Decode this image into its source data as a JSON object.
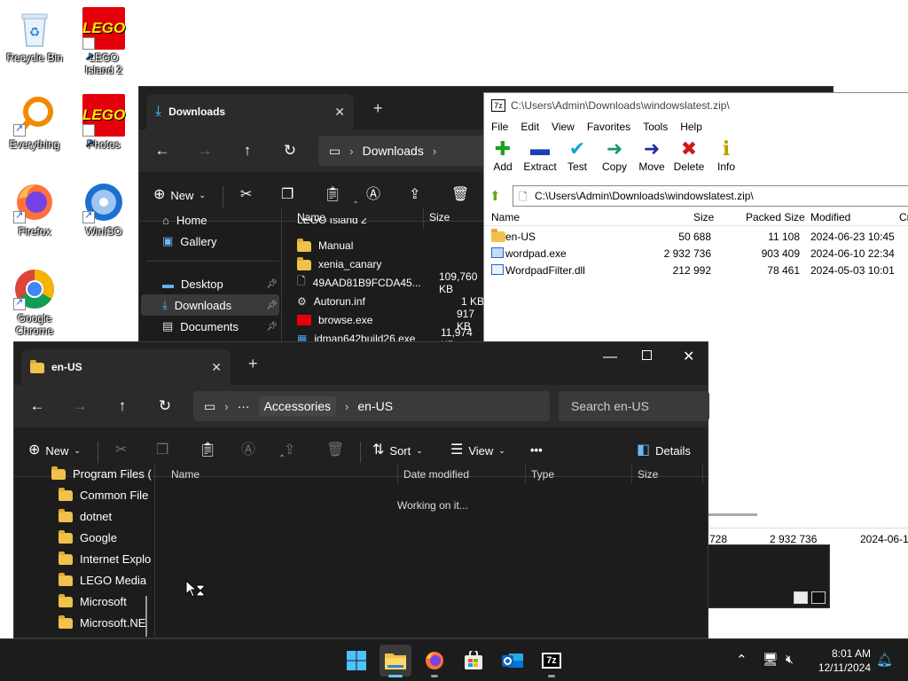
{
  "desktop": {
    "icons": [
      {
        "label": "Recycle Bin",
        "icon": "recycle-bin-icon"
      },
      {
        "label": "LEGO Island 2",
        "icon": "lego-icon"
      },
      {
        "label": "Everything",
        "icon": "everything-search-icon"
      },
      {
        "label": "Photos",
        "icon": "lego-icon"
      },
      {
        "label": "Firefox",
        "icon": "firefox-icon"
      },
      {
        "label": "WinISO",
        "icon": "disc-icon"
      },
      {
        "label": "Google Chrome",
        "icon": "chrome-icon"
      }
    ],
    "lego_text": "LEGO"
  },
  "downloads_window": {
    "tab_title": "Downloads",
    "breadcrumb": "Downloads",
    "commands": {
      "new": "New"
    },
    "nav": [
      {
        "label": "Home",
        "icon": "home-icon"
      },
      {
        "label": "Gallery",
        "icon": "gallery-icon"
      },
      {
        "label": "Desktop",
        "icon": "desktop-icon",
        "pinned": true
      },
      {
        "label": "Downloads",
        "icon": "download-icon",
        "pinned": true,
        "selected": true
      },
      {
        "label": "Documents",
        "icon": "documents-icon",
        "pinned": true
      }
    ],
    "columns": {
      "name": "Name",
      "size": "Size"
    },
    "files": [
      {
        "name": "LEGO Island 2",
        "size": "",
        "icon": "folder-icon"
      },
      {
        "name": "Manual",
        "size": "",
        "icon": "folder-icon"
      },
      {
        "name": "xenia_canary",
        "size": "",
        "icon": "folder-icon"
      },
      {
        "name": "49AAD81B9FCDA45...",
        "size": "109,760 KB",
        "icon": "file-icon"
      },
      {
        "name": "Autorun.inf",
        "size": "1 KB",
        "icon": "settings-file-icon"
      },
      {
        "name": "browse.exe",
        "size": "917 KB",
        "icon": "lego-exe-icon"
      },
      {
        "name": "idman642build26.exe",
        "size": "11,974 KB",
        "icon": "installer-icon"
      }
    ]
  },
  "zip_window": {
    "title": "C:\\Users\\Admin\\Downloads\\windowslatest.zip\\",
    "logo": "7z",
    "menu": [
      "File",
      "Edit",
      "View",
      "Favorites",
      "Tools",
      "Help"
    ],
    "toolbar": [
      {
        "label": "Add",
        "glyph": "+",
        "color": "#1aa31a",
        "icon": "add-icon"
      },
      {
        "label": "Extract",
        "glyph": "—",
        "color": "#1f3fb5",
        "icon": "extract-icon"
      },
      {
        "label": "Test",
        "glyph": "✓",
        "color": "#15a5c9",
        "icon": "test-icon"
      },
      {
        "label": "Copy",
        "glyph": "➜",
        "color": "#119a72",
        "icon": "copy-icon"
      },
      {
        "label": "Move",
        "glyph": "➜",
        "color": "#1c2fa0",
        "icon": "move-icon"
      },
      {
        "label": "Delete",
        "glyph": "✕",
        "color": "#d01818",
        "icon": "delete-icon"
      },
      {
        "label": "Info",
        "glyph": "i",
        "color": "#b8a000",
        "icon": "info-icon"
      }
    ],
    "address": "C:\\Users\\Admin\\Downloads\\windowslatest.zip\\",
    "columns": {
      "name": "Name",
      "size": "Size",
      "packed": "Packed Size",
      "modified": "Modified",
      "extra": "Cr"
    },
    "files": [
      {
        "name": "en-US",
        "size": "50 688",
        "packed": "11 108",
        "modified": "2024-06-23 10:45",
        "icon": "folder-icon"
      },
      {
        "name": "wordpad.exe",
        "size": "2 932 736",
        "packed": "903 409",
        "modified": "2024-06-10 22:34",
        "icon": "exe-icon"
      },
      {
        "name": "WordpadFilter.dll",
        "size": "212 992",
        "packed": "78 461",
        "modified": "2024-05-03 10:01",
        "icon": "dll-icon"
      }
    ],
    "status": {
      "size": "728",
      "packed": "2 932 736",
      "modified": "2024-06-1"
    }
  },
  "enus_window": {
    "tab_title": "en-US",
    "breadcrumb": [
      "Accessories",
      "en-US"
    ],
    "search_placeholder": "Search en-US",
    "commands": {
      "new": "New",
      "sort": "Sort",
      "view": "View",
      "details": "Details"
    },
    "tree": [
      {
        "label": "Program Files (",
        "indent": 0
      },
      {
        "label": "Common File",
        "indent": 1
      },
      {
        "label": "dotnet",
        "indent": 1
      },
      {
        "label": "Google",
        "indent": 1
      },
      {
        "label": "Internet Explo",
        "indent": 1
      },
      {
        "label": "LEGO Media",
        "indent": 1
      },
      {
        "label": "Microsoft",
        "indent": 1
      },
      {
        "label": "Microsoft.NE",
        "indent": 1
      }
    ],
    "columns": {
      "name": "Name",
      "date": "Date modified",
      "type": "Type",
      "size": "Size"
    },
    "status_text": "Working on it..."
  },
  "taskbar": {
    "apps": [
      {
        "name": "start",
        "icon": "windows-start-icon",
        "active": false,
        "open": false
      },
      {
        "name": "file-explorer",
        "icon": "file-explorer-icon",
        "active": true,
        "open": true
      },
      {
        "name": "firefox",
        "icon": "firefox-icon",
        "active": false,
        "open": true
      },
      {
        "name": "store",
        "icon": "store-icon",
        "active": false,
        "open": false
      },
      {
        "name": "outlook",
        "icon": "outlook-icon",
        "active": false,
        "open": false
      },
      {
        "name": "7zip",
        "icon": "7zip-icon",
        "active": false,
        "open": true
      }
    ],
    "time": "8:01 AM",
    "date": "12/11/2024"
  }
}
